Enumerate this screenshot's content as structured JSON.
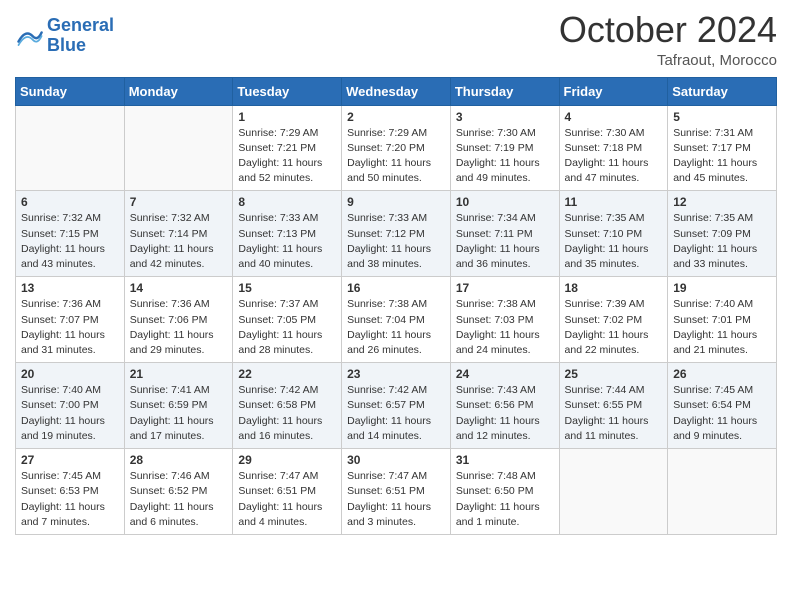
{
  "header": {
    "logo_line1": "General",
    "logo_line2": "Blue",
    "month": "October 2024",
    "location": "Tafraout, Morocco"
  },
  "days_of_week": [
    "Sunday",
    "Monday",
    "Tuesday",
    "Wednesday",
    "Thursday",
    "Friday",
    "Saturday"
  ],
  "weeks": [
    [
      {
        "day": "",
        "sunrise": "",
        "sunset": "",
        "daylight": ""
      },
      {
        "day": "",
        "sunrise": "",
        "sunset": "",
        "daylight": ""
      },
      {
        "day": "1",
        "sunrise": "Sunrise: 7:29 AM",
        "sunset": "Sunset: 7:21 PM",
        "daylight": "Daylight: 11 hours and 52 minutes."
      },
      {
        "day": "2",
        "sunrise": "Sunrise: 7:29 AM",
        "sunset": "Sunset: 7:20 PM",
        "daylight": "Daylight: 11 hours and 50 minutes."
      },
      {
        "day": "3",
        "sunrise": "Sunrise: 7:30 AM",
        "sunset": "Sunset: 7:19 PM",
        "daylight": "Daylight: 11 hours and 49 minutes."
      },
      {
        "day": "4",
        "sunrise": "Sunrise: 7:30 AM",
        "sunset": "Sunset: 7:18 PM",
        "daylight": "Daylight: 11 hours and 47 minutes."
      },
      {
        "day": "5",
        "sunrise": "Sunrise: 7:31 AM",
        "sunset": "Sunset: 7:17 PM",
        "daylight": "Daylight: 11 hours and 45 minutes."
      }
    ],
    [
      {
        "day": "6",
        "sunrise": "Sunrise: 7:32 AM",
        "sunset": "Sunset: 7:15 PM",
        "daylight": "Daylight: 11 hours and 43 minutes."
      },
      {
        "day": "7",
        "sunrise": "Sunrise: 7:32 AM",
        "sunset": "Sunset: 7:14 PM",
        "daylight": "Daylight: 11 hours and 42 minutes."
      },
      {
        "day": "8",
        "sunrise": "Sunrise: 7:33 AM",
        "sunset": "Sunset: 7:13 PM",
        "daylight": "Daylight: 11 hours and 40 minutes."
      },
      {
        "day": "9",
        "sunrise": "Sunrise: 7:33 AM",
        "sunset": "Sunset: 7:12 PM",
        "daylight": "Daylight: 11 hours and 38 minutes."
      },
      {
        "day": "10",
        "sunrise": "Sunrise: 7:34 AM",
        "sunset": "Sunset: 7:11 PM",
        "daylight": "Daylight: 11 hours and 36 minutes."
      },
      {
        "day": "11",
        "sunrise": "Sunrise: 7:35 AM",
        "sunset": "Sunset: 7:10 PM",
        "daylight": "Daylight: 11 hours and 35 minutes."
      },
      {
        "day": "12",
        "sunrise": "Sunrise: 7:35 AM",
        "sunset": "Sunset: 7:09 PM",
        "daylight": "Daylight: 11 hours and 33 minutes."
      }
    ],
    [
      {
        "day": "13",
        "sunrise": "Sunrise: 7:36 AM",
        "sunset": "Sunset: 7:07 PM",
        "daylight": "Daylight: 11 hours and 31 minutes."
      },
      {
        "day": "14",
        "sunrise": "Sunrise: 7:36 AM",
        "sunset": "Sunset: 7:06 PM",
        "daylight": "Daylight: 11 hours and 29 minutes."
      },
      {
        "day": "15",
        "sunrise": "Sunrise: 7:37 AM",
        "sunset": "Sunset: 7:05 PM",
        "daylight": "Daylight: 11 hours and 28 minutes."
      },
      {
        "day": "16",
        "sunrise": "Sunrise: 7:38 AM",
        "sunset": "Sunset: 7:04 PM",
        "daylight": "Daylight: 11 hours and 26 minutes."
      },
      {
        "day": "17",
        "sunrise": "Sunrise: 7:38 AM",
        "sunset": "Sunset: 7:03 PM",
        "daylight": "Daylight: 11 hours and 24 minutes."
      },
      {
        "day": "18",
        "sunrise": "Sunrise: 7:39 AM",
        "sunset": "Sunset: 7:02 PM",
        "daylight": "Daylight: 11 hours and 22 minutes."
      },
      {
        "day": "19",
        "sunrise": "Sunrise: 7:40 AM",
        "sunset": "Sunset: 7:01 PM",
        "daylight": "Daylight: 11 hours and 21 minutes."
      }
    ],
    [
      {
        "day": "20",
        "sunrise": "Sunrise: 7:40 AM",
        "sunset": "Sunset: 7:00 PM",
        "daylight": "Daylight: 11 hours and 19 minutes."
      },
      {
        "day": "21",
        "sunrise": "Sunrise: 7:41 AM",
        "sunset": "Sunset: 6:59 PM",
        "daylight": "Daylight: 11 hours and 17 minutes."
      },
      {
        "day": "22",
        "sunrise": "Sunrise: 7:42 AM",
        "sunset": "Sunset: 6:58 PM",
        "daylight": "Daylight: 11 hours and 16 minutes."
      },
      {
        "day": "23",
        "sunrise": "Sunrise: 7:42 AM",
        "sunset": "Sunset: 6:57 PM",
        "daylight": "Daylight: 11 hours and 14 minutes."
      },
      {
        "day": "24",
        "sunrise": "Sunrise: 7:43 AM",
        "sunset": "Sunset: 6:56 PM",
        "daylight": "Daylight: 11 hours and 12 minutes."
      },
      {
        "day": "25",
        "sunrise": "Sunrise: 7:44 AM",
        "sunset": "Sunset: 6:55 PM",
        "daylight": "Daylight: 11 hours and 11 minutes."
      },
      {
        "day": "26",
        "sunrise": "Sunrise: 7:45 AM",
        "sunset": "Sunset: 6:54 PM",
        "daylight": "Daylight: 11 hours and 9 minutes."
      }
    ],
    [
      {
        "day": "27",
        "sunrise": "Sunrise: 7:45 AM",
        "sunset": "Sunset: 6:53 PM",
        "daylight": "Daylight: 11 hours and 7 minutes."
      },
      {
        "day": "28",
        "sunrise": "Sunrise: 7:46 AM",
        "sunset": "Sunset: 6:52 PM",
        "daylight": "Daylight: 11 hours and 6 minutes."
      },
      {
        "day": "29",
        "sunrise": "Sunrise: 7:47 AM",
        "sunset": "Sunset: 6:51 PM",
        "daylight": "Daylight: 11 hours and 4 minutes."
      },
      {
        "day": "30",
        "sunrise": "Sunrise: 7:47 AM",
        "sunset": "Sunset: 6:51 PM",
        "daylight": "Daylight: 11 hours and 3 minutes."
      },
      {
        "day": "31",
        "sunrise": "Sunrise: 7:48 AM",
        "sunset": "Sunset: 6:50 PM",
        "daylight": "Daylight: 11 hours and 1 minute."
      },
      {
        "day": "",
        "sunrise": "",
        "sunset": "",
        "daylight": ""
      },
      {
        "day": "",
        "sunrise": "",
        "sunset": "",
        "daylight": ""
      }
    ]
  ]
}
